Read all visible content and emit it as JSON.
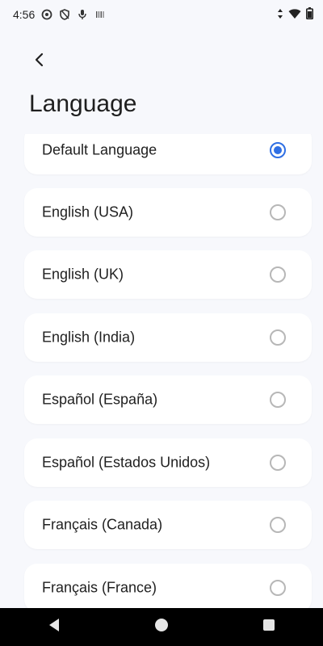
{
  "status_bar": {
    "time": "4:56",
    "left_icons": [
      "circle-status-icon",
      "shield-status-icon",
      "mic-status-icon",
      "barcode-status-icon"
    ],
    "right_icons": [
      "data-arrows-icon",
      "wifi-icon",
      "battery-icon"
    ]
  },
  "header": {
    "back_icon": "chevron-left-icon",
    "title": "Language"
  },
  "languages": {
    "items": [
      {
        "label": "Default Language",
        "selected": true
      },
      {
        "label": "English (USA)",
        "selected": false
      },
      {
        "label": "English (UK)",
        "selected": false
      },
      {
        "label": "English (India)",
        "selected": false
      },
      {
        "label": "Español (España)",
        "selected": false
      },
      {
        "label": "Español (Estados Unidos)",
        "selected": false
      },
      {
        "label": "Français (Canada)",
        "selected": false
      },
      {
        "label": "Français (France)",
        "selected": false
      }
    ]
  },
  "colors": {
    "accent": "#2f6fe4",
    "background": "#f7f8fc",
    "card": "#ffffff",
    "nav_bar": "#000000"
  },
  "nav_bar": {
    "buttons": [
      "back-triangle-icon",
      "home-circle-icon",
      "recents-square-icon"
    ]
  }
}
